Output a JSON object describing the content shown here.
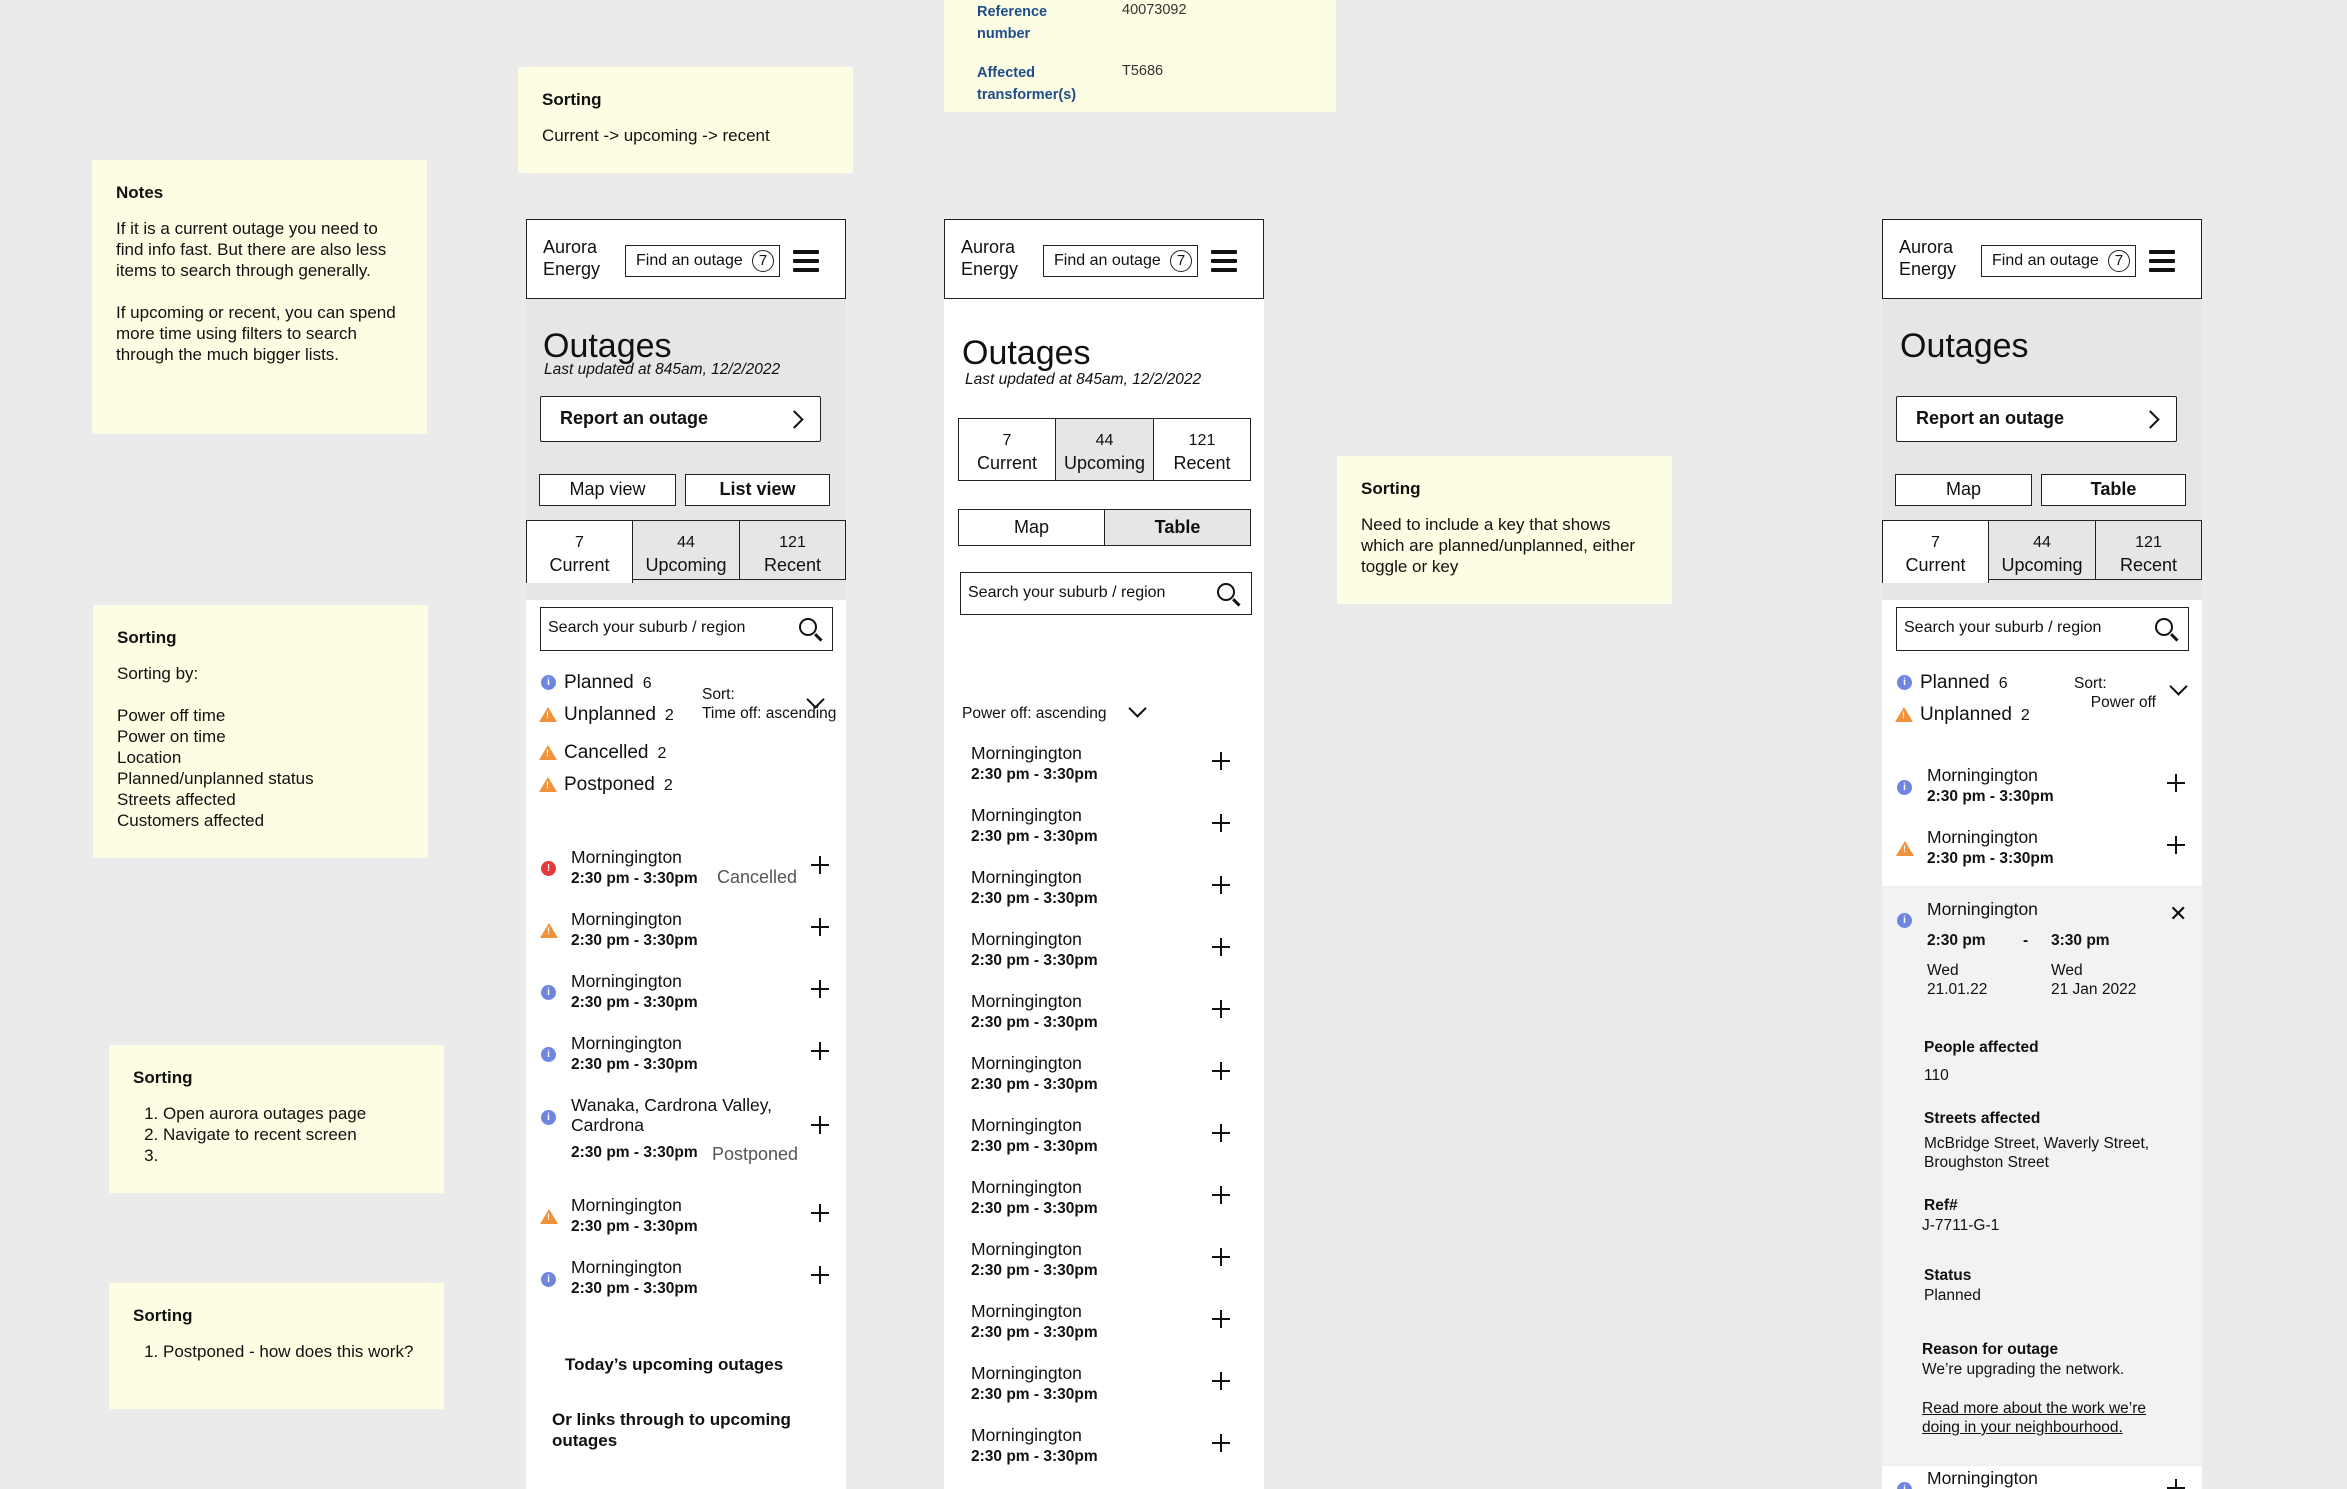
{
  "notes": [
    {
      "title": "Notes",
      "body": "If it is a current outage  you need to find info fast. But there are also less items to search through generally.\n\nIf upcoming or recent, you can spend more time using filters to search through the much bigger lists."
    },
    {
      "title": "Sorting",
      "body": "Sorting by:\n\nPower off time\nPower on time\nLocation\nPlanned/unplanned status\nStreets affected\nCustomers affected"
    },
    {
      "title": "Sorting",
      "items": [
        "Open aurora outages page",
        "Navigate to recent screen",
        ""
      ]
    },
    {
      "title": "Sorting",
      "items": [
        "Postponed - how does this work?"
      ]
    },
    {
      "title": "Sorting",
      "body": "Current -> upcoming -> recent"
    },
    {
      "title": "Sorting",
      "body": "Need to include a key that shows which are planned/unplanned, either toggle or key"
    }
  ],
  "ref_card": {
    "ref_label": "Reference number",
    "ref_value": "40073092",
    "tx_label": "Affected transformer(s)",
    "tx_value": "T5686"
  },
  "common": {
    "brand": "Aurora Energy",
    "find": "Find an outage",
    "help": "7",
    "title": "Outages",
    "updated": "Last updated at 845am,  12/2/2022",
    "report": "Report an outage",
    "search_placeholder": "Search your suburb / region",
    "place": "Morningington",
    "time": "2:30 pm - 3:30pm"
  },
  "frame1": {
    "view_toggle": [
      "Map view",
      "List view"
    ],
    "tabs": [
      {
        "n": "7",
        "l": "Current"
      },
      {
        "n": "44",
        "l": "Upcoming"
      },
      {
        "n": "121",
        "l": "Recent"
      }
    ],
    "legend": [
      {
        "label": "Planned",
        "count": "6"
      },
      {
        "label": "Unplanned",
        "count": "2"
      },
      {
        "label": "Cancelled",
        "count": "2"
      },
      {
        "label": "Postponed",
        "count": "2"
      }
    ],
    "sort_label": "Sort:",
    "sort_value": "Time off: ascending",
    "items": [
      {
        "place": "Morningington",
        "time": "2:30 pm - 3:30pm",
        "status": "Cancelled",
        "icon": "cancelled"
      },
      {
        "place": "Morningington",
        "time": "2:30 pm - 3:30pm",
        "status": "",
        "icon": "unplanned"
      },
      {
        "place": "Morningington",
        "time": "2:30 pm - 3:30pm",
        "status": "",
        "icon": "planned"
      },
      {
        "place": "Morningington",
        "time": "2:30 pm - 3:30pm",
        "status": "",
        "icon": "planned"
      },
      {
        "place": "Wanaka, Cardrona Valley, Cardrona",
        "time": "2:30 pm - 3:30pm",
        "status": "Postponed",
        "icon": "planned"
      },
      {
        "place": "Morningington",
        "time": "2:30 pm - 3:30pm",
        "status": "",
        "icon": "unplanned"
      },
      {
        "place": "Morningington",
        "time": "2:30 pm - 3:30pm",
        "status": "",
        "icon": "planned"
      }
    ],
    "footer1": "Today’s upcoming outages",
    "footer2": "Or links through to upcoming outages"
  },
  "frame2": {
    "tabs": [
      {
        "n": "7",
        "l": "Current"
      },
      {
        "n": "44",
        "l": "Upcoming"
      },
      {
        "n": "121",
        "l": "Recent"
      }
    ],
    "view_toggle": [
      "Map",
      "Table"
    ],
    "sort_value": "Power off: ascending",
    "item_count": 12
  },
  "frame3": {
    "view_toggle": [
      "Map",
      "Table"
    ],
    "tabs": [
      {
        "n": "7",
        "l": "Current"
      },
      {
        "n": "44",
        "l": "Upcoming"
      },
      {
        "n": "121",
        "l": "Recent"
      }
    ],
    "legend": [
      {
        "label": "Planned",
        "count": "6"
      },
      {
        "label": "Unplanned",
        "count": "2"
      }
    ],
    "sort_label": "Sort:",
    "sort_value": "Power off",
    "detail": {
      "place": "Morningington",
      "start_time": "2:30 pm",
      "dash": "-",
      "end_time": "3:30 pm",
      "start_day": "Wed",
      "start_date": "21.01.22",
      "end_day": "Wed",
      "end_date": "21 Jan 2022",
      "people_label": "People affected",
      "people_value": "110",
      "streets_label": "Streets affected",
      "streets_value": "McBridge Street, Waverly Street, Broughston Street",
      "ref_label": "Ref#",
      "ref_value": "J-7711-G-1",
      "status_label": "Status",
      "status_value": "Planned",
      "reason_label": "Reason for outage",
      "reason_value": "We’re upgrading the network.",
      "link": "Read more about the work we’re doing in your neighbourhood."
    },
    "last_place": "Morningington"
  },
  "colors": {
    "planned": "#6f86e0",
    "unplanned": "#f0923a",
    "cancelled": "#e23b3b",
    "sticky": "#fdfde4",
    "background": "#ebebeb"
  }
}
